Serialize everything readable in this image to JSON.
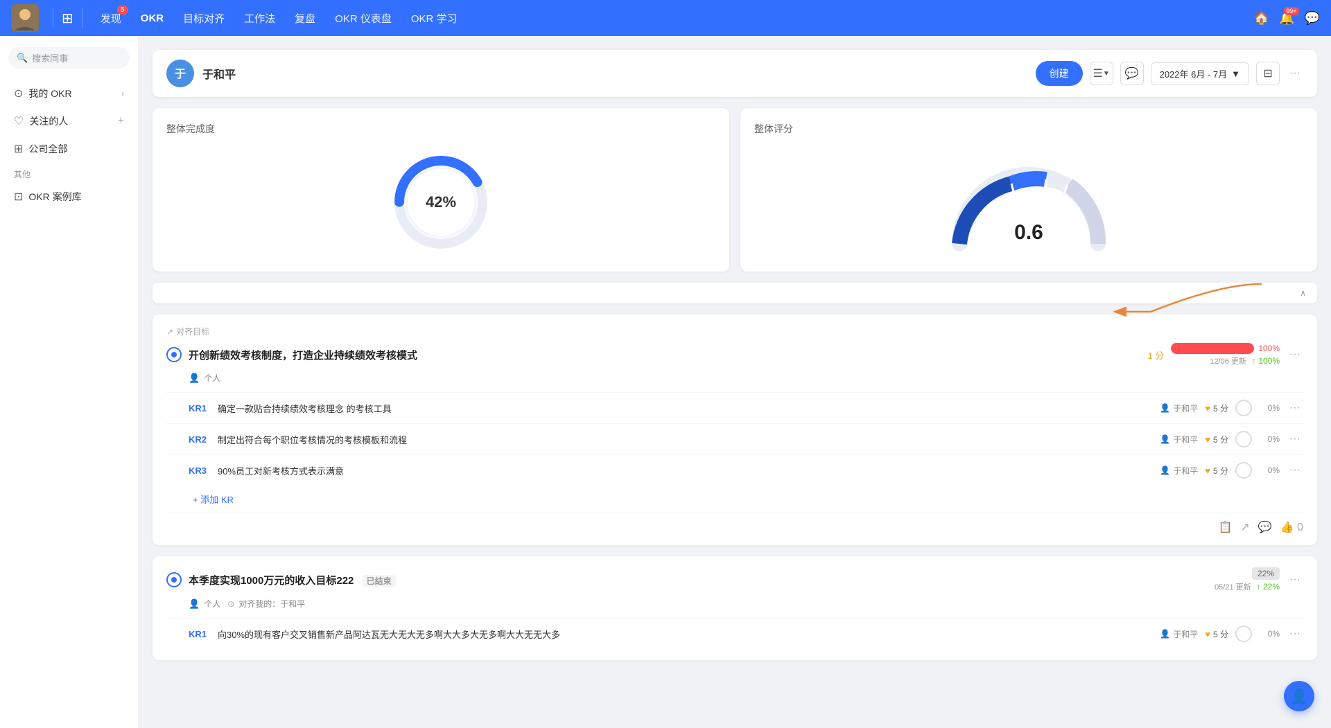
{
  "nav": {
    "items": [
      {
        "label": "发现",
        "badge": "5",
        "active": false
      },
      {
        "label": "OKR",
        "badge": "",
        "active": true
      },
      {
        "label": "目标对齐",
        "badge": "",
        "active": false
      },
      {
        "label": "工作法",
        "badge": "",
        "active": false
      },
      {
        "label": "复盘",
        "badge": "",
        "active": false
      },
      {
        "label": "OKR 仪表盘",
        "badge": "",
        "active": false
      },
      {
        "label": "OKR 学习",
        "badge": "",
        "active": false
      }
    ],
    "icons": {
      "home": "🏠",
      "bell": "🔔",
      "bell_badge": "99+",
      "chat": "💬"
    }
  },
  "sidebar": {
    "search_placeholder": "搜索同事",
    "items": [
      {
        "icon": "⊙",
        "label": "我的 OKR",
        "has_arrow": true
      },
      {
        "icon": "♡",
        "label": "关注的人",
        "has_plus": true
      },
      {
        "icon": "⊞",
        "label": "公司全部",
        "has_arrow": false
      }
    ],
    "section_label": "其他",
    "other_items": [
      {
        "icon": "⊡",
        "label": "OKR 案例库"
      }
    ]
  },
  "profile": {
    "name": "于和平",
    "avatar_text": "于",
    "create_btn": "创建",
    "date_range": "2022年 6月 - 7月",
    "icons": {
      "view": "☰",
      "chat": "💬",
      "filter": "⊟",
      "more": "···"
    }
  },
  "stats": {
    "completion": {
      "title": "整体完成度",
      "value": 42,
      "label": "42%"
    },
    "rating": {
      "title": "整体评分",
      "value": 0.6,
      "label": "0.6"
    }
  },
  "objectives": [
    {
      "align_label": "对齐目标",
      "title": "开创新绩效考核制度，打造企业持续绩效考核模式",
      "score": "1 分",
      "progress": 100,
      "progress_label": "100%",
      "progress_color": "#ff4d4f",
      "update_date": "12/06 更新",
      "update_delta": "↑ 100%",
      "meta_type": "个人",
      "key_results": [
        {
          "label": "KR1",
          "title": "确定一款贴合持续绩效考核理念 的考核工具",
          "assignee": "于和平",
          "score": "5 分",
          "progress": "0%"
        },
        {
          "label": "KR2",
          "title": "制定出符合每个职位考核情况的考核模板和流程",
          "assignee": "于和平",
          "score": "5 分",
          "progress": "0%"
        },
        {
          "label": "KR3",
          "title": "90%员工对新考核方式表示满意",
          "assignee": "于和平",
          "score": "5 分",
          "progress": "0%"
        }
      ],
      "add_kr_label": "+ 添加 KR",
      "footer_actions": {
        "copy": "📋",
        "share": "↗",
        "comment": "💬",
        "like": "👍 0"
      }
    },
    {
      "title": "本季度实现1000万元的收入目标222",
      "ended_badge": "已结束",
      "score": "",
      "progress": 22,
      "progress_label": "22%",
      "progress_color": "#e6e6e6",
      "update_date": "05/21 更新",
      "update_delta": "↑ 22%",
      "meta_type": "个人",
      "align_to": "对齐我的：于和平",
      "key_results": [
        {
          "label": "KR1",
          "title": "向30%的现有客户交叉销售新产品阿达瓦无大无大无多啊大大多大无多啊大大无无大多",
          "assignee": "于和平",
          "score": "5 分",
          "progress": "0%"
        }
      ]
    }
  ],
  "colors": {
    "brand_blue": "#3370ff",
    "danger": "#ff4d4f",
    "warning": "#f5a623",
    "success": "#52c41a",
    "gray": "#e6e6e6"
  }
}
